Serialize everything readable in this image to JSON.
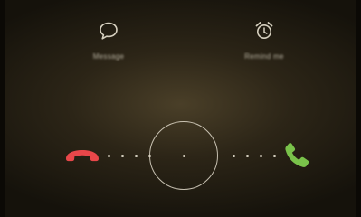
{
  "quick_actions": {
    "message": {
      "label": "Message",
      "icon": "speech-bubble-icon"
    },
    "remind": {
      "label": "Remind me",
      "icon": "alarm-clock-icon"
    }
  },
  "call_controls": {
    "decline": {
      "icon": "phone-hangup-icon",
      "color": "#e8474a"
    },
    "answer": {
      "icon": "phone-icon",
      "color": "#79c24a"
    }
  },
  "colors": {
    "background_center": "#4a3f28",
    "background_edge": "#15120b",
    "decline": "#e8474a",
    "answer": "#79c24a"
  }
}
